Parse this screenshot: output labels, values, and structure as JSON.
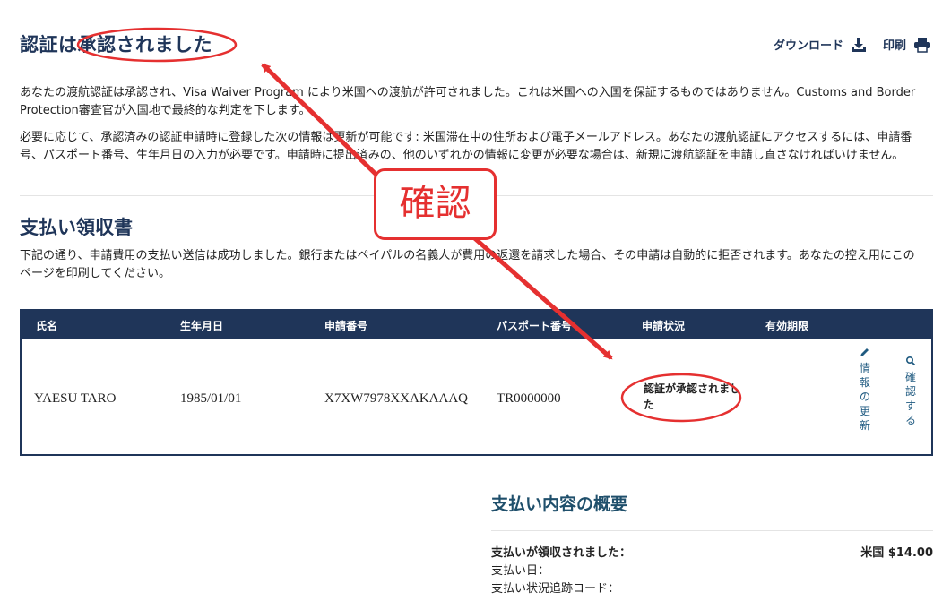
{
  "header": {
    "title": "認証は承認されました",
    "download_label": "ダウンロード",
    "print_label": "印刷"
  },
  "intro": {
    "p1": "あなたの渡航認証は承認され、Visa Waiver Program により米国への渡航が許可されました。これは米国への入国を保証するものではありません。Customs and Border Protection審査官が入国地で最終的な判定を下します。",
    "p2": "必要に応じて、承認済みの認証申請時に登録した次の情報は更新が可能です: 米国滞在中の住所および電子メールアドレス。あなたの渡航認証にアクセスするには、申請番号、パスポート番号、生年月日の入力が必要です。申請時に提出済みの、他のいずれかの情報に変更が必要な場合は、新規に渡航認証を申請し直さなければいけません。"
  },
  "receipt": {
    "title": "支払い領収書",
    "text": "下記の通り、申請費用の支払い送信は成功しました。銀行またはペイパルの名義人が費用の返還を請求した場合、その申請は自動的に拒否されます。あなたの控え用にこのページを印刷してください。"
  },
  "table": {
    "headers": [
      "氏名",
      "生年月日",
      "申請番号",
      "パスポート番号",
      "申請状況",
      "有効期限"
    ],
    "row": {
      "name": "YAESU TARO",
      "dob": "1985/01/01",
      "application_no": "X7XW7978XXAKAAAQ",
      "passport_no": "TR0000000",
      "status": "認証が承認されました",
      "expiry": ""
    },
    "actions": {
      "update": "情報の更新",
      "confirm": "確認する"
    }
  },
  "summary": {
    "title": "支払い内容の概要",
    "received_label": "支払いが領収されました：",
    "amount": "米国 $14.00",
    "date_label": "支払い日：",
    "tracking_label": "支払い状況追跡コード："
  },
  "annotation": {
    "callout_text": "確認",
    "color": "#e53030"
  },
  "colors": {
    "navy": "#1f3559",
    "link": "#1f5a80"
  },
  "icons": {
    "download": "download-icon",
    "print": "printer-icon",
    "pencil": "pencil-icon",
    "magnifier": "search-icon"
  }
}
